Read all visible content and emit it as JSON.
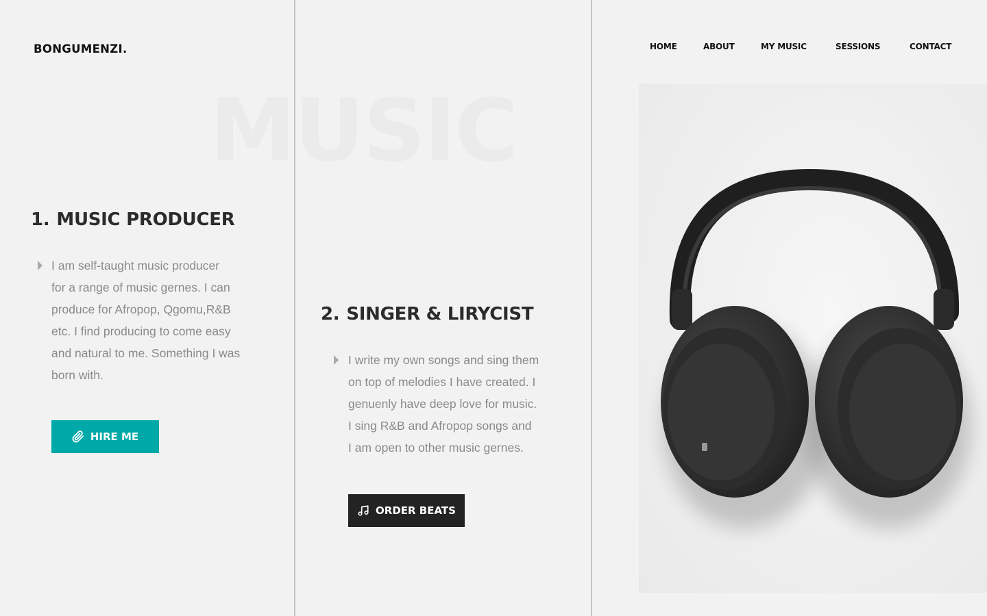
{
  "brand": {
    "logo": "BONGUMENZI."
  },
  "nav": {
    "items": [
      "HOME",
      "ABOUT",
      "MY MUSIC",
      "SESSIONS",
      "CONTACT"
    ]
  },
  "hero": {
    "watermark": "MUSIC"
  },
  "sections": [
    {
      "number": "1.",
      "title": "MUSIC PRODUCER",
      "lines": [
        "I am self-taught music producer",
        "for a range of music gernes. I can",
        "produce for Afropop, Qgomu,R&B",
        "etc. I find producing to come easy",
        "and natural to me. Something I was",
        "born with."
      ],
      "button_label": "HIRE ME",
      "button_icon": "paperclip-icon",
      "button_color": "#00a8a8"
    },
    {
      "number": "2.",
      "title": "SINGER & LIRYCIST",
      "lines": [
        "I write my own songs and sing them",
        "on top of melodies I have created. I",
        "genuenly have deep love for music.",
        "I sing R&B and Afropop songs and",
        "I am open to other music gernes."
      ],
      "button_label": "ORDER BEATS",
      "button_icon": "music-note-icon",
      "button_color": "#232323"
    }
  ],
  "image": {
    "subject": "headphones-image"
  }
}
